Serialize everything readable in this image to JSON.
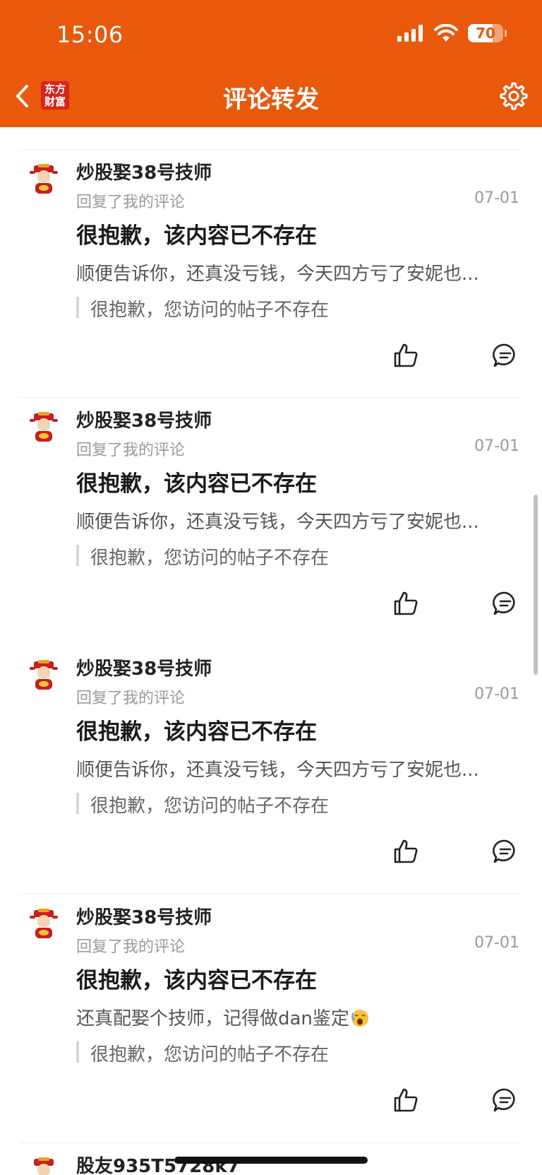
{
  "status_bar": {
    "time": "15:06",
    "battery": "70",
    "battery_level": 0.7
  },
  "nav": {
    "title": "评论转发",
    "logo_line1": "东方",
    "logo_line2": "财富"
  },
  "colors": {
    "brand": "#ea580c",
    "logo_red": "#d8251b"
  },
  "icons": [
    "chevron-left-icon",
    "gear-icon",
    "thumbs-up-icon",
    "comment-icon",
    "avatar-caishen",
    "emoji-face"
  ],
  "items": [
    {
      "username": "炒股娶38号技师",
      "action": "回复了我的评论",
      "date": "07-01",
      "headline": "很抱歉，该内容已不存在",
      "snippet": "顺便告诉你，还真没亏钱，今天四方亏了安妮也...",
      "quote": "很抱歉，您访问的帖子不存在"
    },
    {
      "username": "炒股娶38号技师",
      "action": "回复了我的评论",
      "date": "07-01",
      "headline": "很抱歉，该内容已不存在",
      "snippet": "顺便告诉你，还真没亏钱，今天四方亏了安妮也...",
      "quote": "很抱歉，您访问的帖子不存在"
    },
    {
      "username": "炒股娶38号技师",
      "action": "回复了我的评论",
      "date": "07-01",
      "headline": "很抱歉，该内容已不存在",
      "snippet": "顺便告诉你，还真没亏钱，今天四方亏了安妮也...",
      "quote": "很抱歉，您访问的帖子不存在"
    },
    {
      "username": "炒股娶38号技师",
      "action": "回复了我的评论",
      "date": "07-01",
      "headline": "很抱歉，该内容已不存在",
      "snippet": "还真配娶个技师，记得做dan鉴定",
      "quote": "很抱歉，您访问的帖子不存在"
    }
  ],
  "partial_item": {
    "username": "股友935T5728k7"
  }
}
